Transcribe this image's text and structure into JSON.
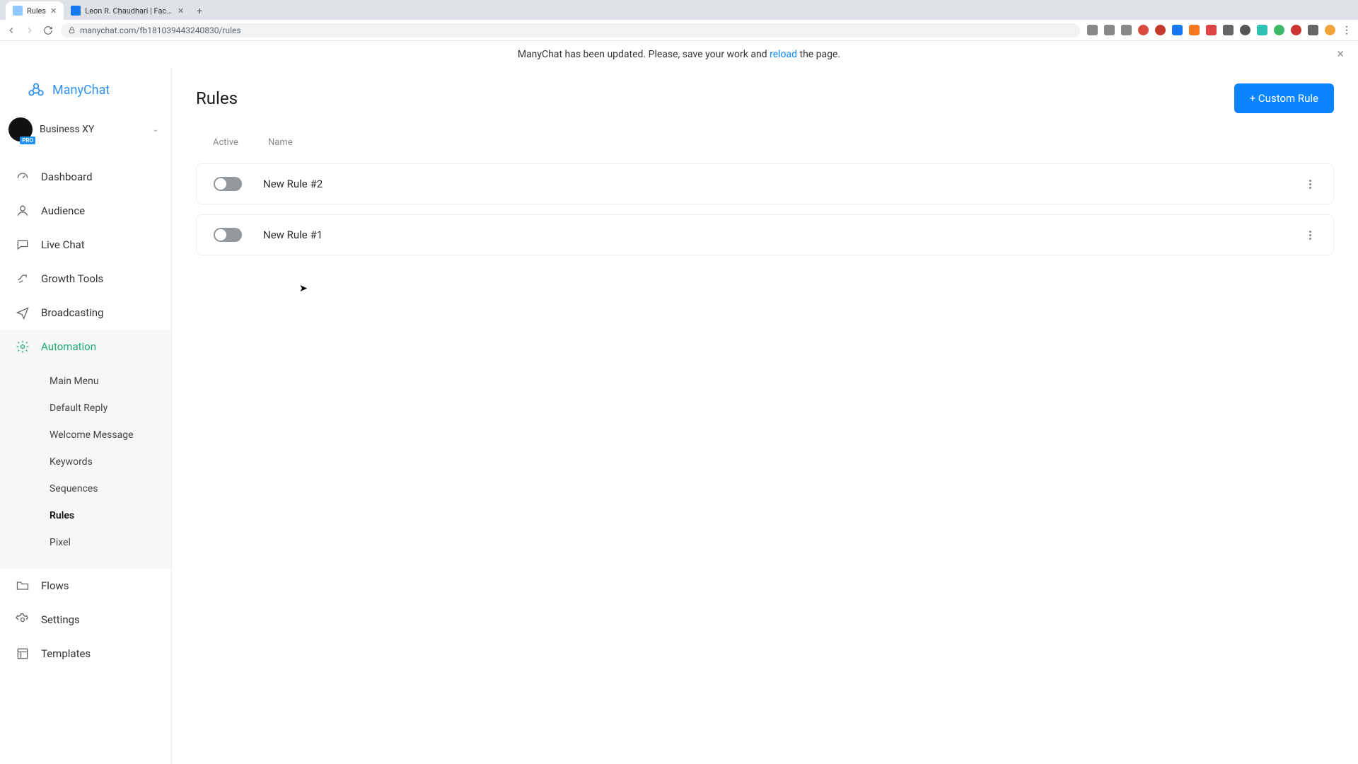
{
  "browser": {
    "tabs": [
      {
        "title": "Rules",
        "active": true
      },
      {
        "title": "Leon R. Chaudhari | Facebook",
        "active": false
      }
    ],
    "url": "manychat.com/fb181039443240830/rules"
  },
  "banner": {
    "text_before": "ManyChat has been updated. Please, save your work and ",
    "link": "reload",
    "text_after": " the page."
  },
  "brand": {
    "name": "ManyChat"
  },
  "workspace": {
    "name": "Business XY",
    "badge": "PRO"
  },
  "nav": {
    "dashboard": "Dashboard",
    "audience": "Audience",
    "live_chat": "Live Chat",
    "growth_tools": "Growth Tools",
    "broadcasting": "Broadcasting",
    "automation": "Automation",
    "flows": "Flows",
    "settings": "Settings",
    "templates": "Templates"
  },
  "subnav": {
    "main_menu": "Main Menu",
    "default_reply": "Default Reply",
    "welcome_message": "Welcome Message",
    "keywords": "Keywords",
    "sequences": "Sequences",
    "rules": "Rules",
    "pixel": "Pixel"
  },
  "page": {
    "title": "Rules",
    "new_rule_btn": "+ Custom Rule",
    "columns": {
      "active": "Active",
      "name": "Name"
    },
    "rules": [
      {
        "name": "New Rule #2",
        "active": false
      },
      {
        "name": "New Rule #1",
        "active": false
      }
    ]
  }
}
